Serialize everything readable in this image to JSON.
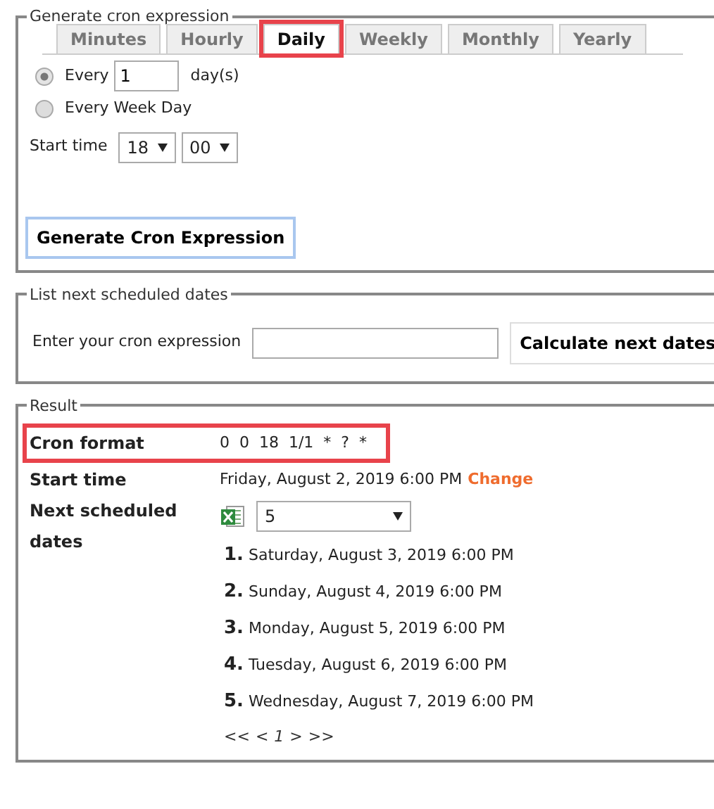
{
  "generate": {
    "legend": "Generate cron expression",
    "tabs": [
      {
        "label": "Minutes",
        "selected": false,
        "highlighted": false
      },
      {
        "label": "Hourly",
        "selected": false,
        "highlighted": false
      },
      {
        "label": "Daily",
        "selected": true,
        "highlighted": true
      },
      {
        "label": "Weekly",
        "selected": false,
        "highlighted": false
      },
      {
        "label": "Monthly",
        "selected": false,
        "highlighted": false
      },
      {
        "label": "Yearly",
        "selected": false,
        "highlighted": false
      }
    ],
    "options": [
      {
        "kind": "every",
        "label": "Every",
        "value": "1",
        "suffix": "day(s)",
        "selected": true
      },
      {
        "kind": "plain",
        "label": "Every Week Day",
        "selected": false
      }
    ],
    "start_time": {
      "label": "Start time",
      "hour": "18",
      "minute": "00"
    },
    "button": "Generate Cron Expression"
  },
  "list": {
    "legend": "List next scheduled dates",
    "label": "Enter your cron expression",
    "button": "Calculate next dates"
  },
  "result": {
    "legend": "Result",
    "cron": {
      "label": "Cron format",
      "value": "0  0  18  1/1  *  ?  *",
      "highlighted": true
    },
    "start": {
      "label": "Start time",
      "value": "Friday, August 2, 2019 6:00 PM",
      "link": "Change"
    },
    "next": {
      "label": "Next scheduled dates",
      "count": "5",
      "dates": [
        {
          "number": "1.",
          "text": "Saturday, August 3, 2019 6:00 PM"
        },
        {
          "number": "2.",
          "text": "Sunday, August 4, 2019 6:00 PM"
        },
        {
          "number": "3.",
          "text": "Monday, August 5, 2019 6:00 PM"
        },
        {
          "number": "4.",
          "text": "Tuesday, August 6, 2019 6:00 PM"
        },
        {
          "number": "5.",
          "text": "Wednesday, August 7, 2019 6:00 PM"
        }
      ],
      "pager": [
        "<<",
        "<",
        "1",
        ">",
        ">>"
      ]
    }
  }
}
